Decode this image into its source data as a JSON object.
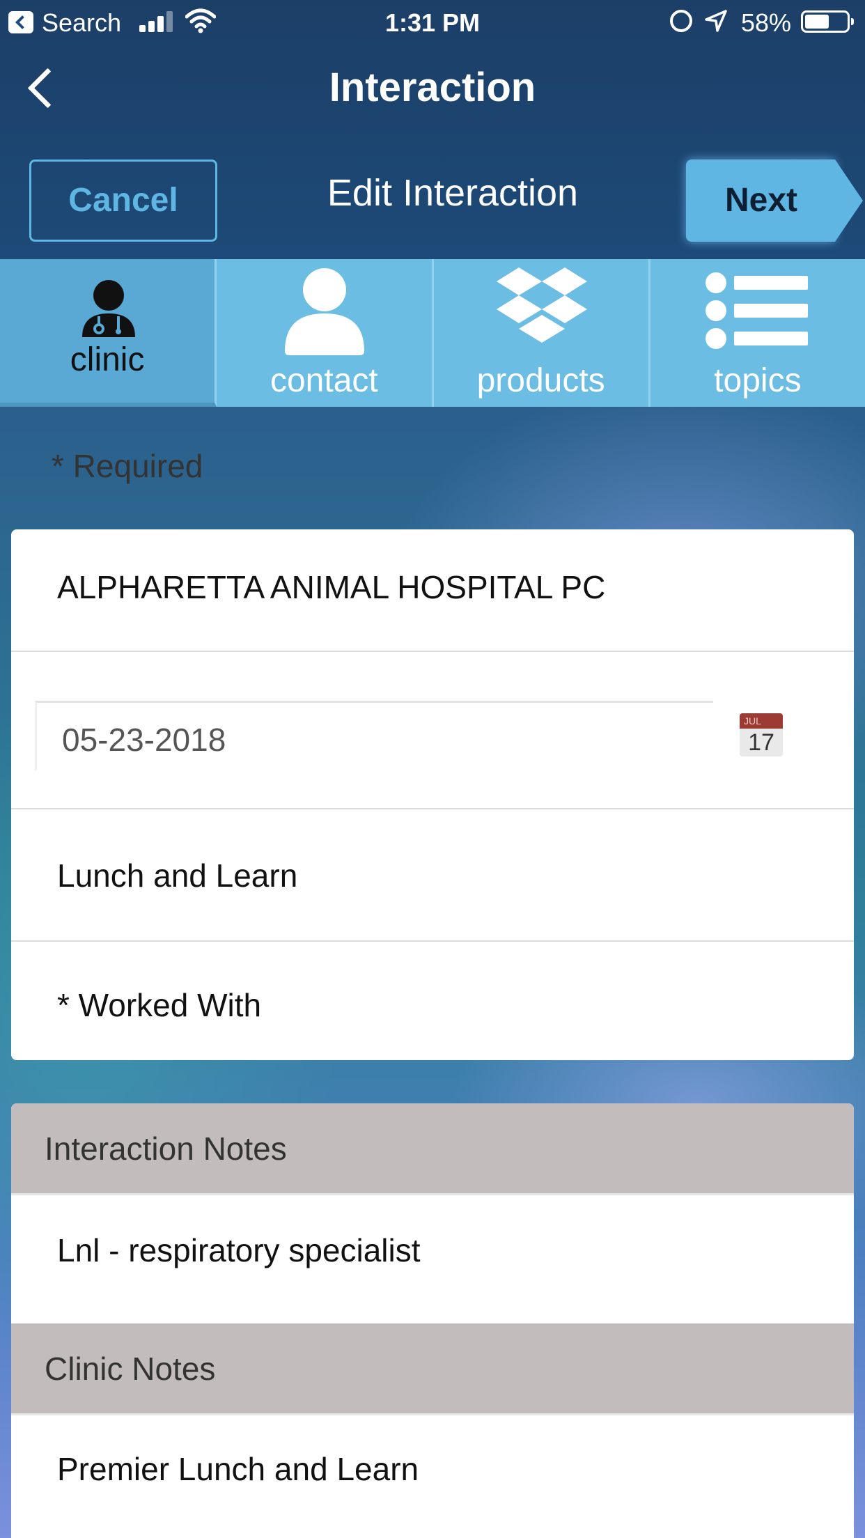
{
  "status_bar": {
    "back_app": "Search",
    "time": "1:31 PM",
    "battery": "58%",
    "battery_level": 0.58
  },
  "nav": {
    "title": "Interaction",
    "cancel_label": "Cancel",
    "subtitle": "Edit Interaction",
    "next_label": "Next"
  },
  "tabs": [
    {
      "label": "clinic",
      "icon": "doctor-icon",
      "active": true
    },
    {
      "label": "contact",
      "icon": "person-icon",
      "active": false
    },
    {
      "label": "products",
      "icon": "dropbox-boxes-icon",
      "active": false
    },
    {
      "label": "topics",
      "icon": "list-icon",
      "active": false
    }
  ],
  "form": {
    "required_note": "* Required",
    "clinic_name": "ALPHARETTA ANIMAL HOSPITAL PC",
    "date": "05-23-2018",
    "calendar_month": "JUL",
    "calendar_day": "17",
    "interaction_type": "Lunch and Learn",
    "worked_with": "* Worked With"
  },
  "notes": {
    "interaction_header": "Interaction Notes",
    "interaction_text": "Lnl - respiratory specialist",
    "clinic_header": "Clinic Notes",
    "clinic_text": "Premier Lunch and Learn"
  },
  "colors": {
    "header_bg": "#1d4a78",
    "accent": "#5fb6e3",
    "tab_bg": "#6bbde4",
    "section_header_bg": "#c3bcbc"
  }
}
